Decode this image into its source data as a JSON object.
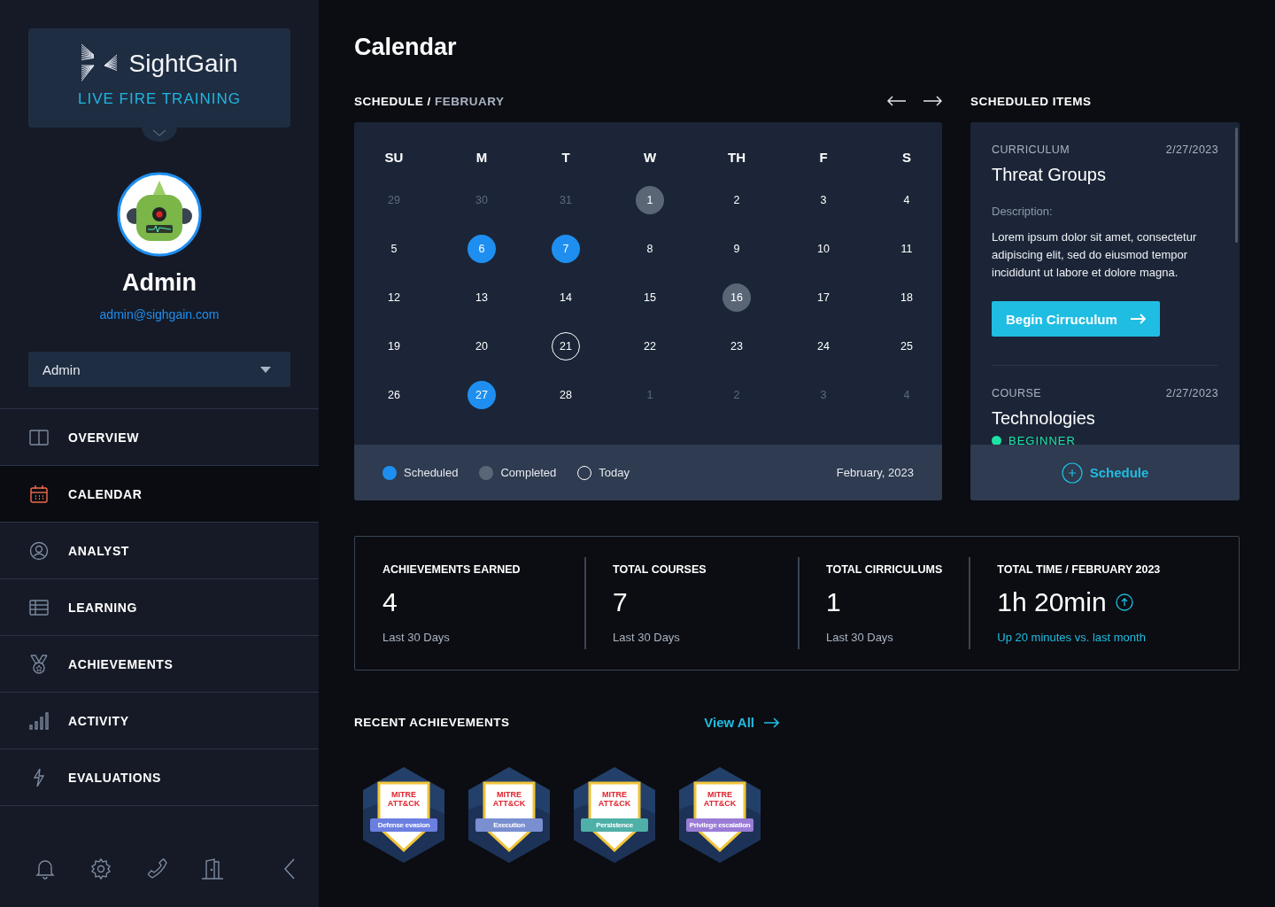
{
  "brand": {
    "name": "SightGain",
    "tagline": "LIVE FIRE TRAINING"
  },
  "user": {
    "name": "Admin",
    "email": "admin@sighgain.com",
    "role": "Admin"
  },
  "nav": [
    {
      "label": "OVERVIEW",
      "selected": false
    },
    {
      "label": "CALENDAR",
      "selected": true
    },
    {
      "label": "ANALYST",
      "selected": false
    },
    {
      "label": "LEARNING",
      "selected": false
    },
    {
      "label": "ACHIEVEMENTS",
      "selected": false
    },
    {
      "label": "ACTIVITY",
      "selected": false
    },
    {
      "label": "EVALUATIONS",
      "selected": false
    }
  ],
  "page_title": "Calendar",
  "schedule": {
    "heading": "SCHEDULE /",
    "month": "FEBRUARY",
    "weekdays": [
      "SU",
      "M",
      "T",
      "W",
      "TH",
      "F",
      "S"
    ],
    "days": [
      {
        "day": "29",
        "other_month": true,
        "scheduled": false,
        "completed": false,
        "today": false
      },
      {
        "day": "30",
        "other_month": true,
        "scheduled": false,
        "completed": false,
        "today": false
      },
      {
        "day": "31",
        "other_month": true,
        "scheduled": false,
        "completed": false,
        "today": false
      },
      {
        "day": "1",
        "other_month": false,
        "scheduled": false,
        "completed": true,
        "today": false
      },
      {
        "day": "2",
        "other_month": false,
        "scheduled": false,
        "completed": false,
        "today": false
      },
      {
        "day": "3",
        "other_month": false,
        "scheduled": false,
        "completed": false,
        "today": false
      },
      {
        "day": "4",
        "other_month": false,
        "scheduled": false,
        "completed": false,
        "today": false
      },
      {
        "day": "5",
        "other_month": false,
        "scheduled": false,
        "completed": false,
        "today": false
      },
      {
        "day": "6",
        "other_month": false,
        "scheduled": true,
        "completed": false,
        "today": false
      },
      {
        "day": "7",
        "other_month": false,
        "scheduled": true,
        "completed": false,
        "today": false
      },
      {
        "day": "8",
        "other_month": false,
        "scheduled": false,
        "completed": false,
        "today": false
      },
      {
        "day": "9",
        "other_month": false,
        "scheduled": false,
        "completed": false,
        "today": false
      },
      {
        "day": "10",
        "other_month": false,
        "scheduled": false,
        "completed": false,
        "today": false
      },
      {
        "day": "11",
        "other_month": false,
        "scheduled": false,
        "completed": false,
        "today": false
      },
      {
        "day": "12",
        "other_month": false,
        "scheduled": false,
        "completed": false,
        "today": false
      },
      {
        "day": "13",
        "other_month": false,
        "scheduled": false,
        "completed": false,
        "today": false
      },
      {
        "day": "14",
        "other_month": false,
        "scheduled": false,
        "completed": false,
        "today": false
      },
      {
        "day": "15",
        "other_month": false,
        "scheduled": false,
        "completed": false,
        "today": false
      },
      {
        "day": "16",
        "other_month": false,
        "scheduled": false,
        "completed": true,
        "today": false
      },
      {
        "day": "17",
        "other_month": false,
        "scheduled": false,
        "completed": false,
        "today": false
      },
      {
        "day": "18",
        "other_month": false,
        "scheduled": false,
        "completed": false,
        "today": false
      },
      {
        "day": "19",
        "other_month": false,
        "scheduled": false,
        "completed": false,
        "today": false
      },
      {
        "day": "20",
        "other_month": false,
        "scheduled": false,
        "completed": false,
        "today": false
      },
      {
        "day": "21",
        "other_month": false,
        "scheduled": false,
        "completed": false,
        "today": true
      },
      {
        "day": "22",
        "other_month": false,
        "scheduled": false,
        "completed": false,
        "today": false
      },
      {
        "day": "23",
        "other_month": false,
        "scheduled": false,
        "completed": false,
        "today": false
      },
      {
        "day": "24",
        "other_month": false,
        "scheduled": false,
        "completed": false,
        "today": false
      },
      {
        "day": "25",
        "other_month": false,
        "scheduled": false,
        "completed": false,
        "today": false
      },
      {
        "day": "26",
        "other_month": false,
        "scheduled": false,
        "completed": false,
        "today": false
      },
      {
        "day": "27",
        "other_month": false,
        "scheduled": true,
        "completed": false,
        "today": false
      },
      {
        "day": "28",
        "other_month": false,
        "scheduled": false,
        "completed": false,
        "today": false
      },
      {
        "day": "1",
        "other_month": true,
        "scheduled": false,
        "completed": false,
        "today": false
      },
      {
        "day": "2",
        "other_month": true,
        "scheduled": false,
        "completed": false,
        "today": false
      },
      {
        "day": "3",
        "other_month": true,
        "scheduled": false,
        "completed": false,
        "today": false
      },
      {
        "day": "4",
        "other_month": true,
        "scheduled": false,
        "completed": false,
        "today": false
      }
    ],
    "legend": [
      {
        "label": "Scheduled",
        "kind": "scheduled"
      },
      {
        "label": "Completed",
        "kind": "completed"
      },
      {
        "label": "Today",
        "kind": "today"
      }
    ],
    "month_label": "February, 2023"
  },
  "scheduled_items": {
    "heading": "SCHEDULED ITEMS",
    "items": [
      {
        "type": "CURRICULUM",
        "date": "2/27/2023",
        "title": "Threat Groups",
        "description_label": "Description:",
        "description": "Lorem ipsum dolor sit amet, consectetur adipiscing elit, sed do eiusmod tempor incididunt ut labore et dolore magna.",
        "action": "Begin Cirruculum"
      },
      {
        "type": "COURSE",
        "date": "2/27/2023",
        "title": "Technologies",
        "level": "BEGINNER",
        "color": "#1ee3a4"
      }
    ],
    "schedule_button": "Schedule"
  },
  "stats": [
    {
      "label": "ACHIEVEMENTS EARNED",
      "value": "4",
      "note": "Last 30 Days",
      "kind": "plain"
    },
    {
      "label": "TOTAL COURSES",
      "value": "7",
      "note": "Last 30 Days",
      "kind": "plain"
    },
    {
      "label": "TOTAL CIRRICULUMS",
      "value": "1",
      "note": "Last 30 Days",
      "kind": "plain"
    },
    {
      "label": "TOTAL TIME / FEBRUARY 2023",
      "value": "1h 20min",
      "note": "Up 20 minutes vs. last month",
      "kind": "trend"
    }
  ],
  "recent": {
    "heading": "RECENT ACHIEVEMENTS",
    "view_all": "View All",
    "badges": [
      {
        "brand": "MITRE ATT&CK",
        "label": "Defense evasion",
        "color": "#6b7fe0"
      },
      {
        "brand": "MITRE ATT&CK",
        "label": "Execution",
        "color": "#7a8fd0"
      },
      {
        "brand": "MITRE ATT&CK",
        "label": "Persistence",
        "color": "#4fb0a8"
      },
      {
        "brand": "MITRE ATT&CK",
        "label": "Privilege escalation",
        "color": "#9a7cd6"
      }
    ]
  }
}
